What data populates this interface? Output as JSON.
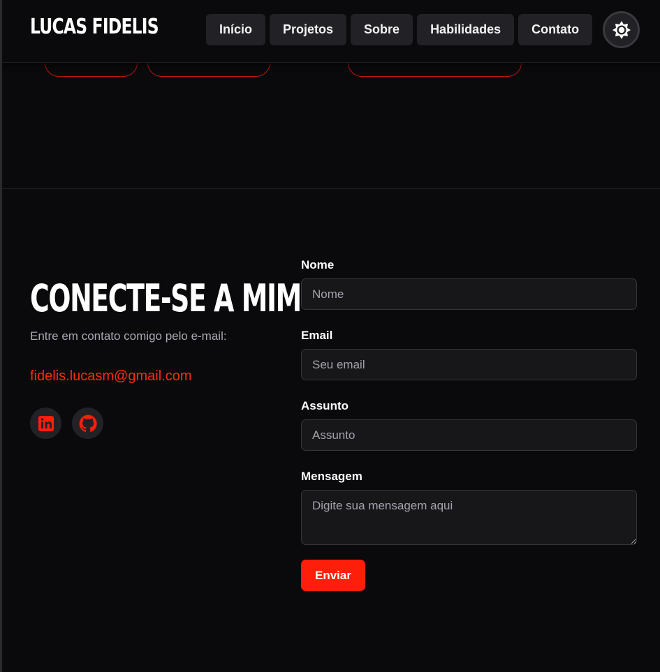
{
  "header": {
    "logo": "LUCAS FIDELIS",
    "nav": [
      {
        "label": "Início"
      },
      {
        "label": "Projetos"
      },
      {
        "label": "Sobre"
      },
      {
        "label": "Habilidades"
      },
      {
        "label": "Contato"
      }
    ],
    "theme_icon": "sun-icon"
  },
  "contact": {
    "title": "CONECTE-SE A MIM",
    "subtitle": "Entre em contato comigo pelo e-mail:",
    "email": "fidelis.lucasm@gmail.com",
    "socials": [
      {
        "icon": "linkedin-icon"
      },
      {
        "icon": "github-icon"
      }
    ]
  },
  "form": {
    "name": {
      "label": "Nome",
      "placeholder": "Nome",
      "value": ""
    },
    "email": {
      "label": "Email",
      "placeholder": "Seu email",
      "value": ""
    },
    "subject": {
      "label": "Assunto",
      "placeholder": "Assunto",
      "value": ""
    },
    "message": {
      "label": "Mensagem",
      "placeholder": "Digite sua mensagem aqui",
      "value": ""
    },
    "submit_label": "Enviar"
  },
  "colors": {
    "background": "#0a0a0c",
    "surface": "#222226",
    "accent": "#ff1e0a",
    "muted_text": "#a9a9b3"
  }
}
